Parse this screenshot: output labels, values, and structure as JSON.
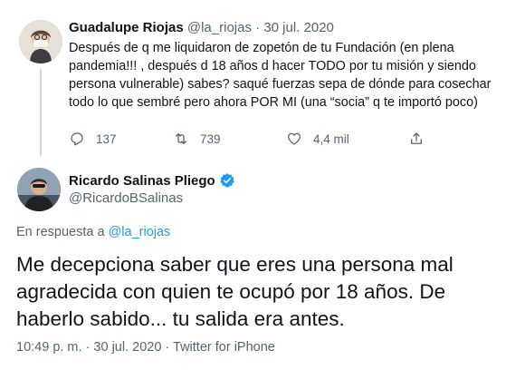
{
  "parent_tweet": {
    "author_name": "Guadalupe Riojas",
    "handle": "@la_riojas",
    "separator": "·",
    "date": "30 jul. 2020",
    "text": "Después de q me liquidaron de zopetón de tu Fundación (en plena pandemia!!! , después d 18 años d hacer TODO por tu misión y siendo persona vulnerable) sabes? saqué fuerzas sepa de dónde para cosechar todo lo que sembré pero ahora POR MI (una “socia” q te importó poco)",
    "reply_count": "137",
    "retweet_count": "739",
    "like_count": "4,4 mil",
    "icons": [
      "reply-icon",
      "retweet-icon",
      "like-icon",
      "share-icon"
    ]
  },
  "main_tweet": {
    "author_name": "Ricardo Salinas Pliego",
    "handle": "@RicardoBSalinas",
    "reply_prefix": "En respuesta a",
    "reply_to_handle": "@la_riojas",
    "text": "Me decepciona saber que eres una persona mal agradecida con quien te ocupó por 18 años. De haberlo sabido... tu salida era antes.",
    "timestamp": "10:49 p. m. · 30 jul. 2020 · Twitter for iPhone"
  },
  "colors": {
    "text": "#0f1419",
    "muted": "#536471",
    "link": "#1d9bf0",
    "thread_line": "#cfd9de"
  }
}
